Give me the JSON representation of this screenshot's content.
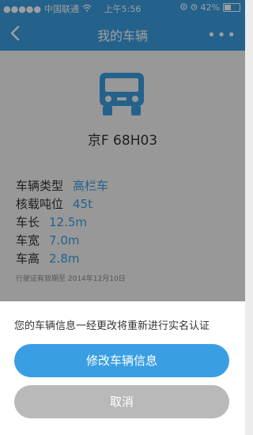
{
  "status_bar": {
    "signal_dots": "●●●●●",
    "carrier": "中国联通",
    "time": "上午5:56",
    "battery": "42%",
    "battery_level": 0.42
  },
  "nav": {
    "title": "我的车辆",
    "back_icon": "chevron-left-icon",
    "more_label": "•••"
  },
  "vehicle": {
    "plate": "京F 68H03",
    "info": [
      {
        "label": "车辆类型",
        "value": "高栏车"
      },
      {
        "label": "核载吨位",
        "value": "45t"
      },
      {
        "label": "车长",
        "value": "12.5m"
      },
      {
        "label": "车宽",
        "value": "7.0m"
      },
      {
        "label": "车高",
        "value": "2.8m"
      }
    ],
    "license_note": "行驶证有效期至 2014年12月10日"
  },
  "sheet": {
    "message": "您的车辆信息一经更改将重新进行实名认证",
    "primary_button": "修改车辆信息",
    "cancel_button": "取消"
  },
  "colors": {
    "accent": "#3a9ee3",
    "cancel": "#b9b9b9"
  }
}
